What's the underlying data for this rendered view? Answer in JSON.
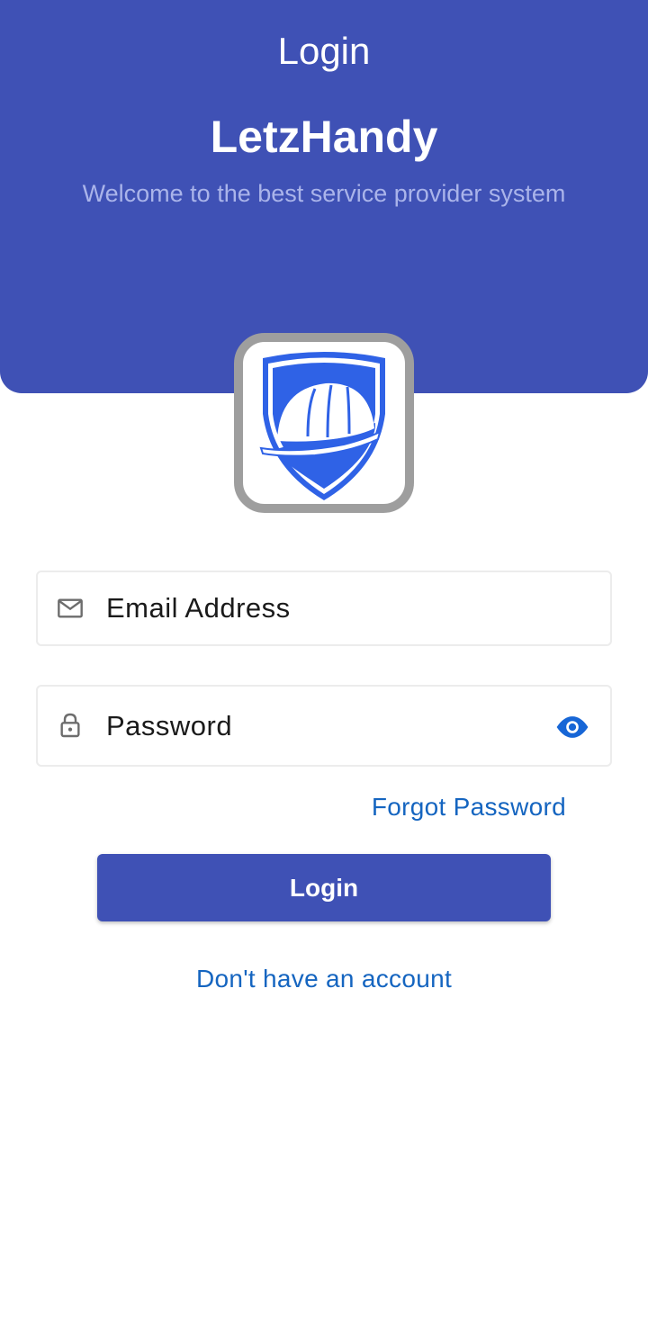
{
  "header": {
    "title": "Login",
    "brand": "LetzHandy",
    "tagline": "Welcome to the best service provider system"
  },
  "logo": {
    "icon": "hard-hat-shield-icon"
  },
  "form": {
    "email_placeholder": "Email Address",
    "password_placeholder": "Password",
    "forgot_label": "Forgot Password",
    "login_label": "Login",
    "signup_label": "Don't have an account"
  },
  "icons": {
    "email": "mail-icon",
    "password": "lock-icon",
    "visibility": "eye-icon"
  },
  "colors": {
    "primary": "#3f51b5",
    "link": "#1565c0",
    "tagline": "#aab4ea",
    "logo_blue": "#2f62e6"
  }
}
